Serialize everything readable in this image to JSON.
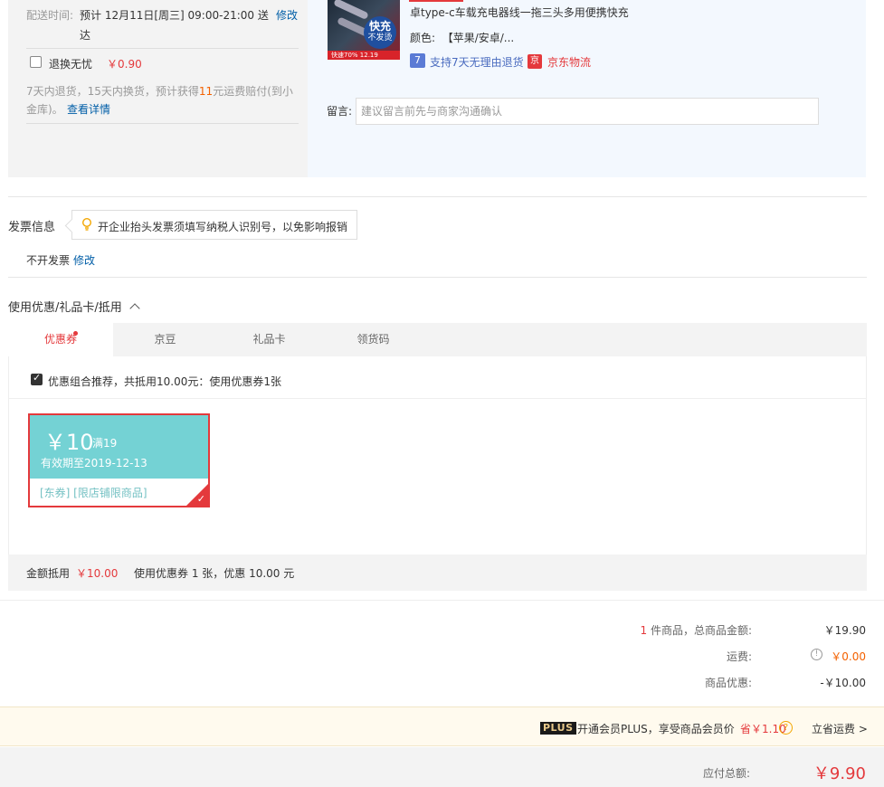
{
  "delivery": {
    "label": "配送时间:",
    "time_line1": "预计 12月11日[周三] 09:00-21:00 送",
    "time_line2": "达",
    "modify": "修改",
    "return_label": "退换无忧",
    "return_price": "￥0.90",
    "desc_part1": "7天内退货，15天内换货，预计获得",
    "desc_highlight": "11",
    "desc_part2": "元运费赔付(到小",
    "desc_line2": "金库)。",
    "detail_link": "查看详情"
  },
  "product": {
    "title": "卓type-c车载充电器线一拖三头多用便携快充",
    "color_label": "颜色:",
    "color_value": "【苹果/安卓/...",
    "badge_7": "7",
    "return_text": "支持7天无理由退货",
    "badge_jd": "京",
    "logistics": "京东物流",
    "img_fast": "快充",
    "img_sub": "不发烫",
    "img_strip": "快速70% 12.19"
  },
  "remark": {
    "label": "留言:",
    "placeholder": "建议留言前先与商家沟通确认"
  },
  "invoice": {
    "title": "发票信息",
    "tip": "开企业抬头发票须填写纳税人识别号，以免影响报销",
    "value": "不开发票",
    "modify": "修改"
  },
  "discount": {
    "title": "使用优惠/礼品卡/抵用",
    "tabs": [
      "优惠券",
      "京豆",
      "礼品卡",
      "领货码"
    ],
    "recommend": "优惠组合推荐，共抵用10.00元：使用优惠券1张",
    "coupon": {
      "amount": "￥10",
      "condition": "满19",
      "expiry": "有效期至2019-12-13",
      "tags": "[东券]  [限店铺限商品]"
    },
    "summary_label": "金额抵用",
    "summary_amount": "￥10.00",
    "summary_desc": "使用优惠券 1 张，优惠 10.00 元"
  },
  "totals": {
    "count": "1",
    "items_label": " 件商品，总商品金额:",
    "items_value": "￥19.90",
    "shipping_label": "运费:",
    "shipping_value": "￥0.00",
    "discount_label": "商品优惠:",
    "discount_value": "-￥10.00"
  },
  "plus": {
    "badge": "PLUS",
    "text": "开通会员PLUS，享受商品会员价",
    "save": "省￥1.10",
    "action": "立省运费 >"
  },
  "pay": {
    "label": "应付总额:",
    "amount": "￥9.90"
  },
  "colors": {
    "accent": "#e4393c",
    "link": "#005ea7",
    "coupon": "#74d2d4",
    "orange": "#f36100"
  }
}
